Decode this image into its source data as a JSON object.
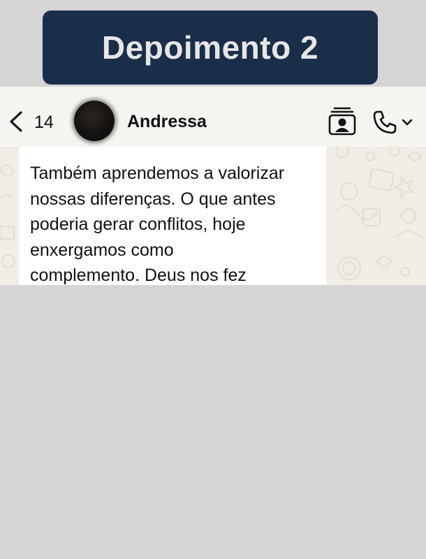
{
  "banner": {
    "title": "Depoimento 2"
  },
  "chat_header": {
    "unread_count": "14",
    "contact_name": "Andressa",
    "icons": {
      "back": "chevron-left-icon",
      "avatar": "contact-avatar",
      "video": "video-call-icon",
      "call": "phone-icon",
      "call_menu": "chevron-down-icon"
    }
  },
  "message": {
    "text": "Também aprendemos a valorizar\nnossas diferenças. O que antes\npoderia gerar conflitos, hoje\nenxergamos como\ncomplemento. Deus nos fez"
  },
  "colors": {
    "banner_bg": "#1a2e4a",
    "banner_text": "#e6e6e6",
    "page_bg": "#d5d5d5",
    "chat_bg": "#f1ede6",
    "bubble_bg": "#ffffff"
  }
}
